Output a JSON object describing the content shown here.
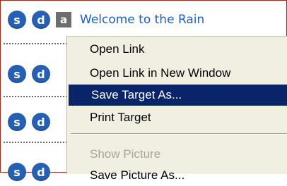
{
  "page": {
    "link_text": "Welcome to the Rain",
    "rows": [
      {
        "icon1": "s",
        "icon2": "d",
        "icon3": "a"
      },
      {
        "icon1": "s",
        "icon2": "d"
      },
      {
        "icon1": "s",
        "icon2": "d"
      },
      {
        "icon1": "s",
        "icon2": "d"
      }
    ]
  },
  "context_menu": {
    "items": [
      {
        "label": "Open Link",
        "state": "normal"
      },
      {
        "label": "Open Link in New Window",
        "state": "normal"
      },
      {
        "label": "Save Target As...",
        "state": "selected"
      },
      {
        "label": "Print Target",
        "state": "normal"
      },
      {
        "label": "Show Picture",
        "state": "disabled"
      },
      {
        "label": "Save Picture As...",
        "state": "normal"
      }
    ]
  },
  "colors": {
    "frame_border": "#9b2a1a",
    "icon_blue": "#2560b5",
    "link_blue": "#1f5fbf",
    "menu_bg": "#f1efe2",
    "menu_highlight": "#0a246a",
    "disabled_text": "#a7a59c"
  }
}
